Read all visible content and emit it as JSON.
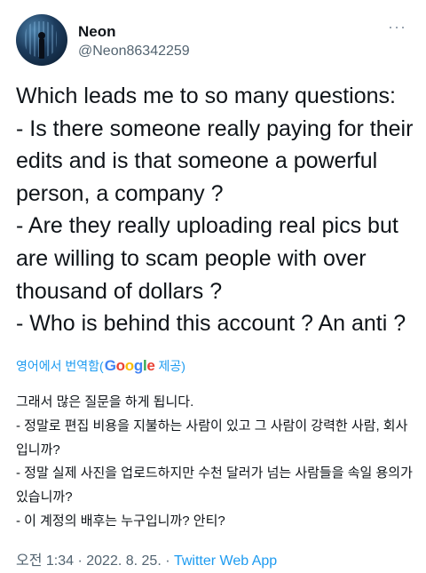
{
  "author": {
    "display_name": "Neon",
    "handle": "@Neon86342259"
  },
  "more_icon": "···",
  "tweet": {
    "text": "Which leads me to so many questions:\n- Is there someone really paying for their edits and is that someone a powerful person, a company ?\n- Are they really uploading real pics but are willing to scam people with over thousand of dollars ?\n- Who is behind this account ? An anti ?"
  },
  "translation": {
    "prefix": "영어에서 번역함(",
    "brand": "Google",
    "suffix": "제공)",
    "text": "그래서 많은 질문을 하게 됩니다.\n- 정말로 편집 비용을 지불하는 사람이 있고 그 사람이 강력한 사람, 회사입니까?\n- 정말 실제 사진을 업로드하지만 수천 달러가 넘는 사람들을 속일 용의가 있습니까?\n- 이 계정의 배후는 누구입니까? 안티?"
  },
  "meta": {
    "time": "오전 1:34",
    "sep1": " · ",
    "date": "2022. 8. 25.",
    "sep2": " · ",
    "source": "Twitter Web App"
  },
  "colors": {
    "link": "#1d9bf0",
    "secondary_text": "#536471",
    "primary_text": "#0f1419"
  }
}
